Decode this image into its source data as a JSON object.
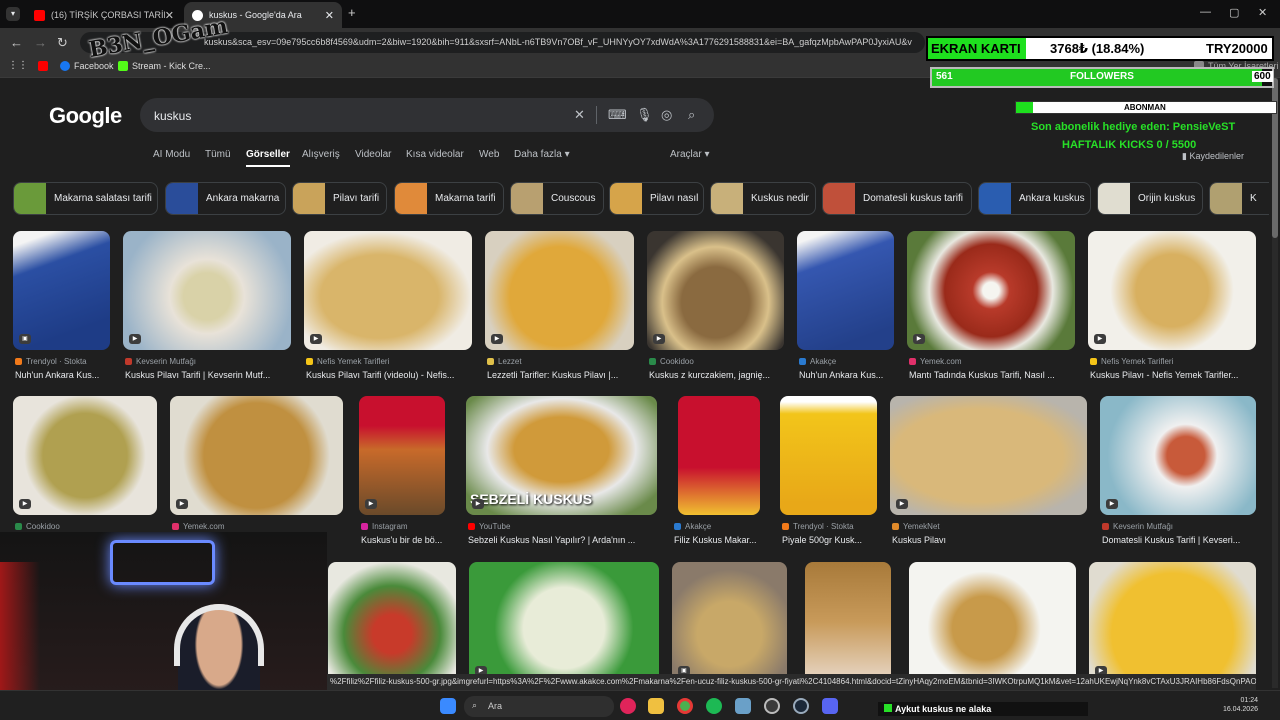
{
  "browser": {
    "tabs": [
      {
        "title": "(16) TİRŞİK ÇORBASI TARİFİ/tirş",
        "favicon_color": "#ff0000"
      },
      {
        "title": "kuskus - Google'da Ara",
        "favicon_color": "#ffffff"
      }
    ],
    "new_tab": "+",
    "url": "kuskus&sca_esv=09e795cc6b8f4569&udm=2&biw=1920&bih=911&sxsrf=ANbL-n6TB9Vn7OBf_vF_UHNYyOY7xdWdA%3A1776291588831&ei=BA_gafqzMpbAwPAP0JyxiAU&v",
    "bookmarks": [
      "Facebook",
      "Stream - Kick Cre..."
    ],
    "all_bookmarks": "Tüm Yer İşaretleri"
  },
  "google": {
    "logo": "Google",
    "query": "kuskus",
    "nav": [
      "AI Modu",
      "Tümü",
      "Görseller",
      "Alışveriş",
      "Videolar",
      "Kısa videolar",
      "Web",
      "Daha fazla ▾"
    ],
    "tools": "Araçlar ▾",
    "saved": "Kaydedilenler",
    "chips": [
      {
        "label": "Makarna salatası tarifi",
        "color": "#6a9a3a"
      },
      {
        "label": "Ankara makarna",
        "color": "#2a4d9a"
      },
      {
        "label": "Pilavı tarifi",
        "color": "#c9a35a"
      },
      {
        "label": "Makarna tarifi",
        "color": "#e08a3a"
      },
      {
        "label": "Couscous",
        "color": "#b8a070"
      },
      {
        "label": "Pilavı nasıl",
        "color": "#d6a44a"
      },
      {
        "label": "Kuskus nedir",
        "color": "#c8b07a"
      },
      {
        "label": "Domatesli kuskus tarifi",
        "color": "#c0503a"
      },
      {
        "label": "Ankara kuskus",
        "color": "#2a5db0"
      },
      {
        "label": "Orijin kuskus",
        "color": "#e0ddd0"
      },
      {
        "label": "K",
        "color": "#b0a070"
      }
    ],
    "results_row1": [
      {
        "source": "Trendyol · Stokta",
        "title": "Nuh'un Ankara Kus...",
        "color": "#2b4fa3",
        "fav": "#f27a1a"
      },
      {
        "source": "Kevserin Mutfağı",
        "title": "Kuskus Pilavı Tarifi | Kevserin Mutf...",
        "color": "#c9b38a",
        "fav": "#c0392b"
      },
      {
        "source": "Nefis Yemek Tarifleri",
        "title": "Kuskus Pilavı Tarifi (videolu) - Nefis...",
        "color": "#d9b56a",
        "fav": "#f5c518"
      },
      {
        "source": "Lezzet",
        "title": "Lezzetli Tarifler: Kuskus Pilavı |...",
        "color": "#e0a83a",
        "fav": "#e0c04a"
      },
      {
        "source": "Cookidoo",
        "title": "Kuskus z kurczakiem, jagnię...",
        "color": "#8a6a40",
        "fav": "#2a8a4a"
      },
      {
        "source": "Akakçe",
        "title": "Nuh'un Ankara Kus...",
        "color": "#3557b0",
        "fav": "#2a7ad0"
      },
      {
        "source": "Yemek.com",
        "title": "Mantı Tadında Kuskus Tarifi, Nasıl ...",
        "color": "#b83a2a",
        "fav": "#e0306a"
      },
      {
        "source": "Nefis Yemek Tarifleri",
        "title": "Kuskus Pilavı - Nefis Yemek Tarifler...",
        "color": "#d8b060",
        "fav": "#f5c518"
      }
    ],
    "results_row2": [
      {
        "source": "Cookidoo",
        "title": "",
        "color": "#b0a050",
        "fav": "#2a8a4a"
      },
      {
        "source": "Yemek.com",
        "title": "",
        "color": "#c09040",
        "fav": "#e0306a"
      },
      {
        "source": "Instagram",
        "title": "Kuskus'u bir de bö...",
        "color": "#c86a2a",
        "fav": "#d6249f"
      },
      {
        "source": "YouTube",
        "title": "Sebzeli Kuskus Nasıl Yapılır? | Arda'nın ...",
        "color": "#d09a3a",
        "fav": "#ff0000",
        "overlay": "SEBZELİ KUSKUS"
      },
      {
        "source": "Akakçe",
        "title": "Filiz Kuskus Makar...",
        "color": "#c8102e",
        "fav": "#2a7ad0"
      },
      {
        "source": "Trendyol · Stokta",
        "title": "Piyale 500gr Kusk...",
        "color": "#f2c51a",
        "fav": "#f27a1a"
      },
      {
        "source": "YemekNet",
        "title": "Kuskus Pilavı",
        "color": "#d9b87a",
        "fav": "#e08a2a"
      },
      {
        "source": "Kevserin Mutfağı",
        "title": "Domatesli Kuskus Tarifi | Kevseri...",
        "color": "#c85a3a",
        "fav": "#c0392b"
      }
    ],
    "results_row3_colors": [
      "#4a8a3a",
      "#d8d8c8",
      "#c8a868",
      "#a87a3a",
      "#c89a4a",
      "#f0c030"
    ],
    "status_url": "%2Ffiliz%2Ffiliz-kuskus-500-gr.jpg&imgrefurl=https%3A%2F%2Fwww.akakce.com%2Fmakarna%2Fen-ucuz-filiz-kuskus-500-gr-fiyati%2C4104864.html&docid=tZinyHAqy2moEM&tbnid=3IWKOtrpuMQ1kM&vet=12ahUKEwjNqYnk8vCTAxU3JRAIHb86FdsQnPAOe..."
  },
  "overlay": {
    "cpu_label": "EKRAN KARTI",
    "cpu_value": "3768₺ (18.84%)",
    "cpu_target": "TRY20000",
    "followers_current": "561",
    "followers_label": "FOLLOWERS",
    "followers_target": "600",
    "abone_label": "ABONMAN",
    "abone_count": "15",
    "last_gift": "Son abonelik hediye eden: PensieVeST",
    "weekly": "HAFTALIK KICKS 0 / 5500",
    "chat": "Aykut kuskus ne alaka",
    "watermark": "B3N_OGam"
  },
  "taskbar": {
    "search": "Ara",
    "time": "01:24",
    "date": "16.04.2026"
  }
}
